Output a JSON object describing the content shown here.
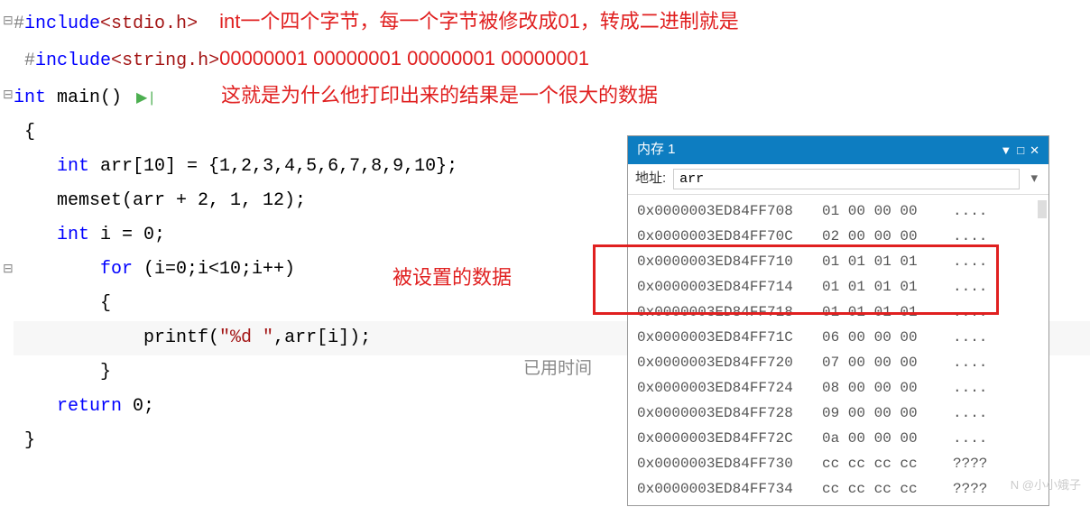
{
  "code": {
    "include1_pre": "#",
    "include1_kw": "include",
    "include1_lt": "<",
    "include1_hdr": "stdio.h",
    "include1_gt": ">",
    "include2_pre": "#",
    "include2_kw": "include",
    "include2_lt": "<",
    "include2_hdr": "string.h",
    "include2_gt": ">",
    "main_kw": "int",
    "main_name": " main()",
    "brace_open": "{",
    "arr_decl_kw": "int",
    "arr_decl": " arr[10] = {1,2,3,4,5,6,7,8,9,10};",
    "memset_call": "    memset(arr + 2, 1, 12);",
    "i_decl_kw": "int",
    "i_decl": " i = 0;",
    "for_kw": "for",
    "for_rest": " (i=0;i<10;i++)",
    "for_brace_open": "        {",
    "printf_indent": "            ",
    "printf_name": "printf(",
    "printf_fmt": "\"%d \"",
    "printf_rest": ",arr[i]);",
    "for_brace_close": "        }",
    "return_kw": "return",
    "return_rest": " 0;",
    "brace_close": "}"
  },
  "annotations": {
    "line1": "int一个四个字节，每一个字节被修改成01，转成二进制就是",
    "line2": "00000001 00000001 00000001 00000001",
    "line3": "这就是为什么他打印出来的结果是一个很大的数据",
    "set_data_label": "被设置的数据",
    "elapsed": "已用时间"
  },
  "memory": {
    "title": "内存 1",
    "addr_label": "地址:",
    "addr_value": "arr",
    "rows": [
      {
        "addr": "0x0000003ED84FF708",
        "bytes": "01 00 00 00",
        "ascii": "...."
      },
      {
        "addr": "0x0000003ED84FF70C",
        "bytes": "02 00 00 00",
        "ascii": "...."
      },
      {
        "addr": "0x0000003ED84FF710",
        "bytes": "01 01 01 01",
        "ascii": "...."
      },
      {
        "addr": "0x0000003ED84FF714",
        "bytes": "01 01 01 01",
        "ascii": "...."
      },
      {
        "addr": "0x0000003ED84FF718",
        "bytes": "01 01 01 01",
        "ascii": "...."
      },
      {
        "addr": "0x0000003ED84FF71C",
        "bytes": "06 00 00 00",
        "ascii": "...."
      },
      {
        "addr": "0x0000003ED84FF720",
        "bytes": "07 00 00 00",
        "ascii": "...."
      },
      {
        "addr": "0x0000003ED84FF724",
        "bytes": "08 00 00 00",
        "ascii": "...."
      },
      {
        "addr": "0x0000003ED84FF728",
        "bytes": "09 00 00 00",
        "ascii": "...."
      },
      {
        "addr": "0x0000003ED84FF72C",
        "bytes": "0a 00 00 00",
        "ascii": "...."
      },
      {
        "addr": "0x0000003ED84FF730",
        "bytes": "cc cc cc cc",
        "ascii": "????"
      },
      {
        "addr": "0x0000003ED84FF734",
        "bytes": "cc cc cc cc",
        "ascii": "????"
      }
    ]
  },
  "watermark": "N @小小娥子"
}
